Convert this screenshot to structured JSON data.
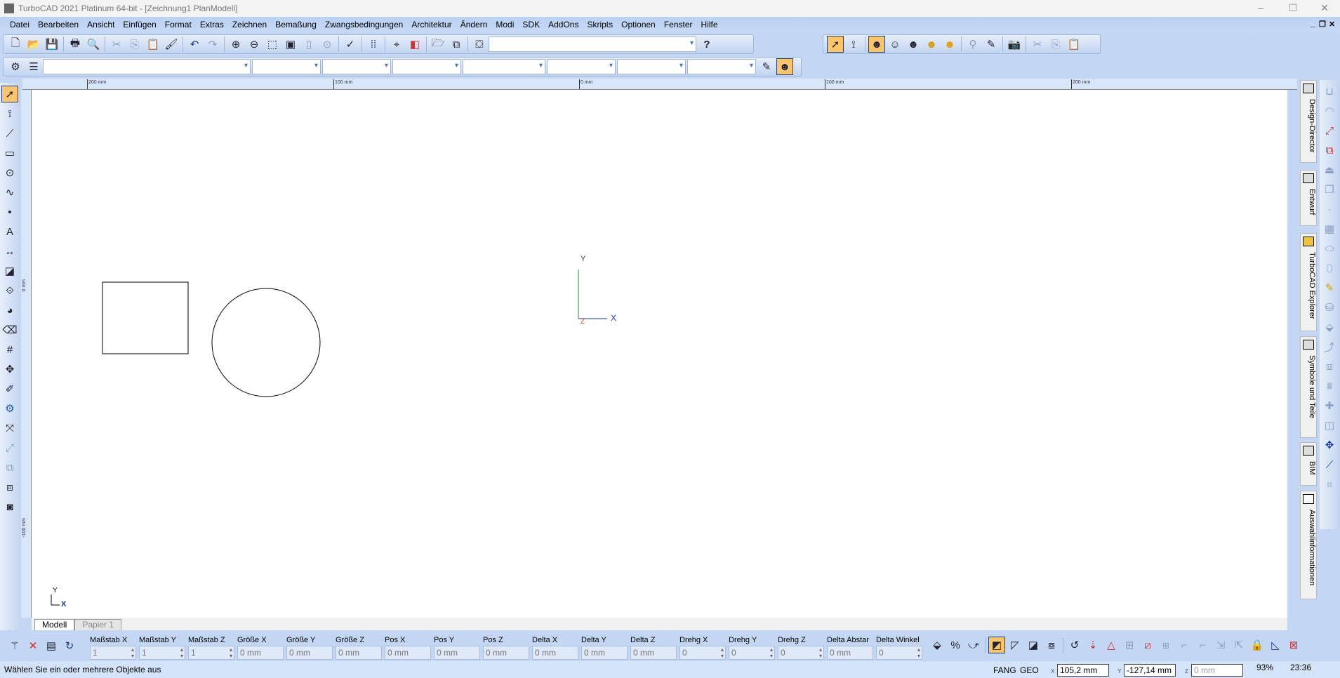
{
  "window": {
    "title": "TurboCAD 2021 Platinum 64-bit - [Zeichnung1 PlanModell]",
    "minimize": "–",
    "maximize": "☐",
    "close": "✕"
  },
  "menu": [
    "Datei",
    "Bearbeiten",
    "Ansicht",
    "Einfügen",
    "Format",
    "Extras",
    "Zeichnen",
    "Bemaßung",
    "Zwangsbedingungen",
    "Architektur",
    "Ändern",
    "Modi",
    "SDK",
    "AddOns",
    "Skripts",
    "Optionen",
    "Fenster",
    "Hilfe"
  ],
  "mdi_controls": {
    "min": "_",
    "restore": "❐",
    "close": "✕"
  },
  "toolbar1": {
    "icons": [
      "new-file",
      "open-folder",
      "save",
      "print",
      "print-preview",
      "cut",
      "copy",
      "paste",
      "format-painter",
      "undo",
      "redo",
      "zoom-in",
      "zoom-out",
      "zoom-window",
      "zoom-extents",
      "zoom-page",
      "zoom-previous",
      "spell-check",
      "grid",
      "snap",
      "layers",
      "open-part",
      "render",
      "design-director"
    ],
    "combo_value": "",
    "help": "?"
  },
  "toolbar_right": {
    "icons": [
      "select",
      "node-edit",
      "render-wire",
      "render-hidden",
      "render-shaded",
      "render-lit",
      "render-full",
      "magnifier",
      "pencil",
      "camera",
      "cut",
      "copy",
      "paste"
    ]
  },
  "ruler": {
    "labels": [
      "200 mm",
      "100 mm",
      "0 mm",
      "100 mm",
      "200 mm"
    ],
    "vlabels": [
      "0 mm",
      "-100 mm"
    ]
  },
  "axis": {
    "x": "X",
    "y": "Y",
    "z": "Z"
  },
  "right_tabs": [
    "Design-Director",
    "Entwurf",
    "TurboCAD Explorer",
    "Symbole und Teile",
    "BIM",
    "Auswahlinformationen"
  ],
  "sheet_tabs": {
    "model": "Modell",
    "paper": "Papier 1"
  },
  "inspector": [
    {
      "label": "Maßstab X",
      "value": "1",
      "spin": true
    },
    {
      "label": "Maßstab Y",
      "value": "1",
      "spin": true
    },
    {
      "label": "Maßstab Z",
      "value": "1",
      "spin": true
    },
    {
      "label": "Größe X",
      "value": "0 mm"
    },
    {
      "label": "Größe Y",
      "value": "0 mm"
    },
    {
      "label": "Größe Z",
      "value": "0 mm"
    },
    {
      "label": "Pos X",
      "value": "0 mm"
    },
    {
      "label": "Pos Y",
      "value": "0 mm"
    },
    {
      "label": "Pos Z",
      "value": "0 mm"
    },
    {
      "label": "Delta X",
      "value": "0 mm"
    },
    {
      "label": "Delta Y",
      "value": "0 mm"
    },
    {
      "label": "Delta Z",
      "value": "0 mm"
    },
    {
      "label": "Drehg X",
      "value": "0",
      "spin": true
    },
    {
      "label": "Drehg Y",
      "value": "0",
      "spin": true
    },
    {
      "label": "Drehg Z",
      "value": "0",
      "spin": true
    },
    {
      "label": "Delta Abstar",
      "value": "0 mm"
    },
    {
      "label": "Delta Winkel",
      "value": "0",
      "spin": true
    }
  ],
  "status": {
    "message": "Wählen Sie ein oder mehrere Objekte aus",
    "fang": "FANG",
    "geo": "GEO",
    "x_label": "X",
    "x": "105,2 mm",
    "y_label": "Y",
    "y": "-127,14 mm",
    "z_label": "Z",
    "z": "0 mm",
    "zoom": "93%",
    "time": "23:36"
  },
  "colors": {
    "accent": "#fbc56b",
    "bg": "#c3d6f3"
  }
}
